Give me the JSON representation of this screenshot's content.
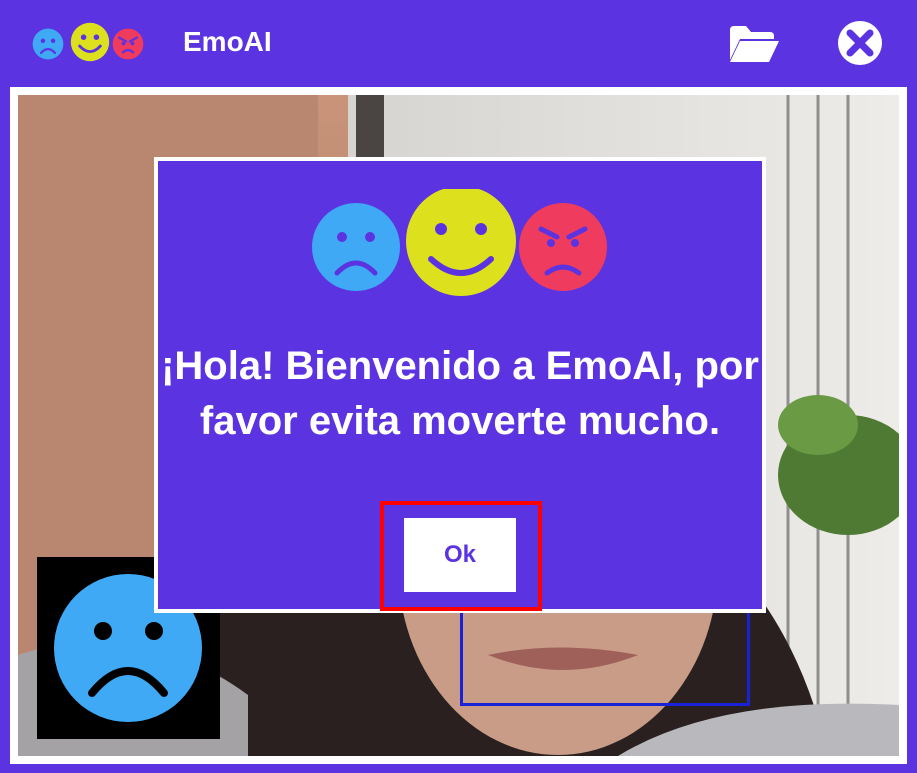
{
  "app": {
    "title": "EmoAI"
  },
  "icons": {
    "logo": [
      "sad-face-icon",
      "happy-face-icon",
      "angry-face-icon"
    ],
    "folder": "folder-open-icon",
    "close": "close-circle-icon"
  },
  "colors": {
    "primary": "#5b33e0",
    "sad": "#3fa9f5",
    "happy": "#dde11d",
    "angry": "#ef3b5e",
    "highlight": "#ff0000",
    "face_box": "#1a22d8"
  },
  "camera": {
    "current_emotion": "sad"
  },
  "dialog": {
    "message": "¡Hola! Bienvenido a EmoAI, por favor evita moverte mucho.",
    "ok_label": "Ok"
  }
}
